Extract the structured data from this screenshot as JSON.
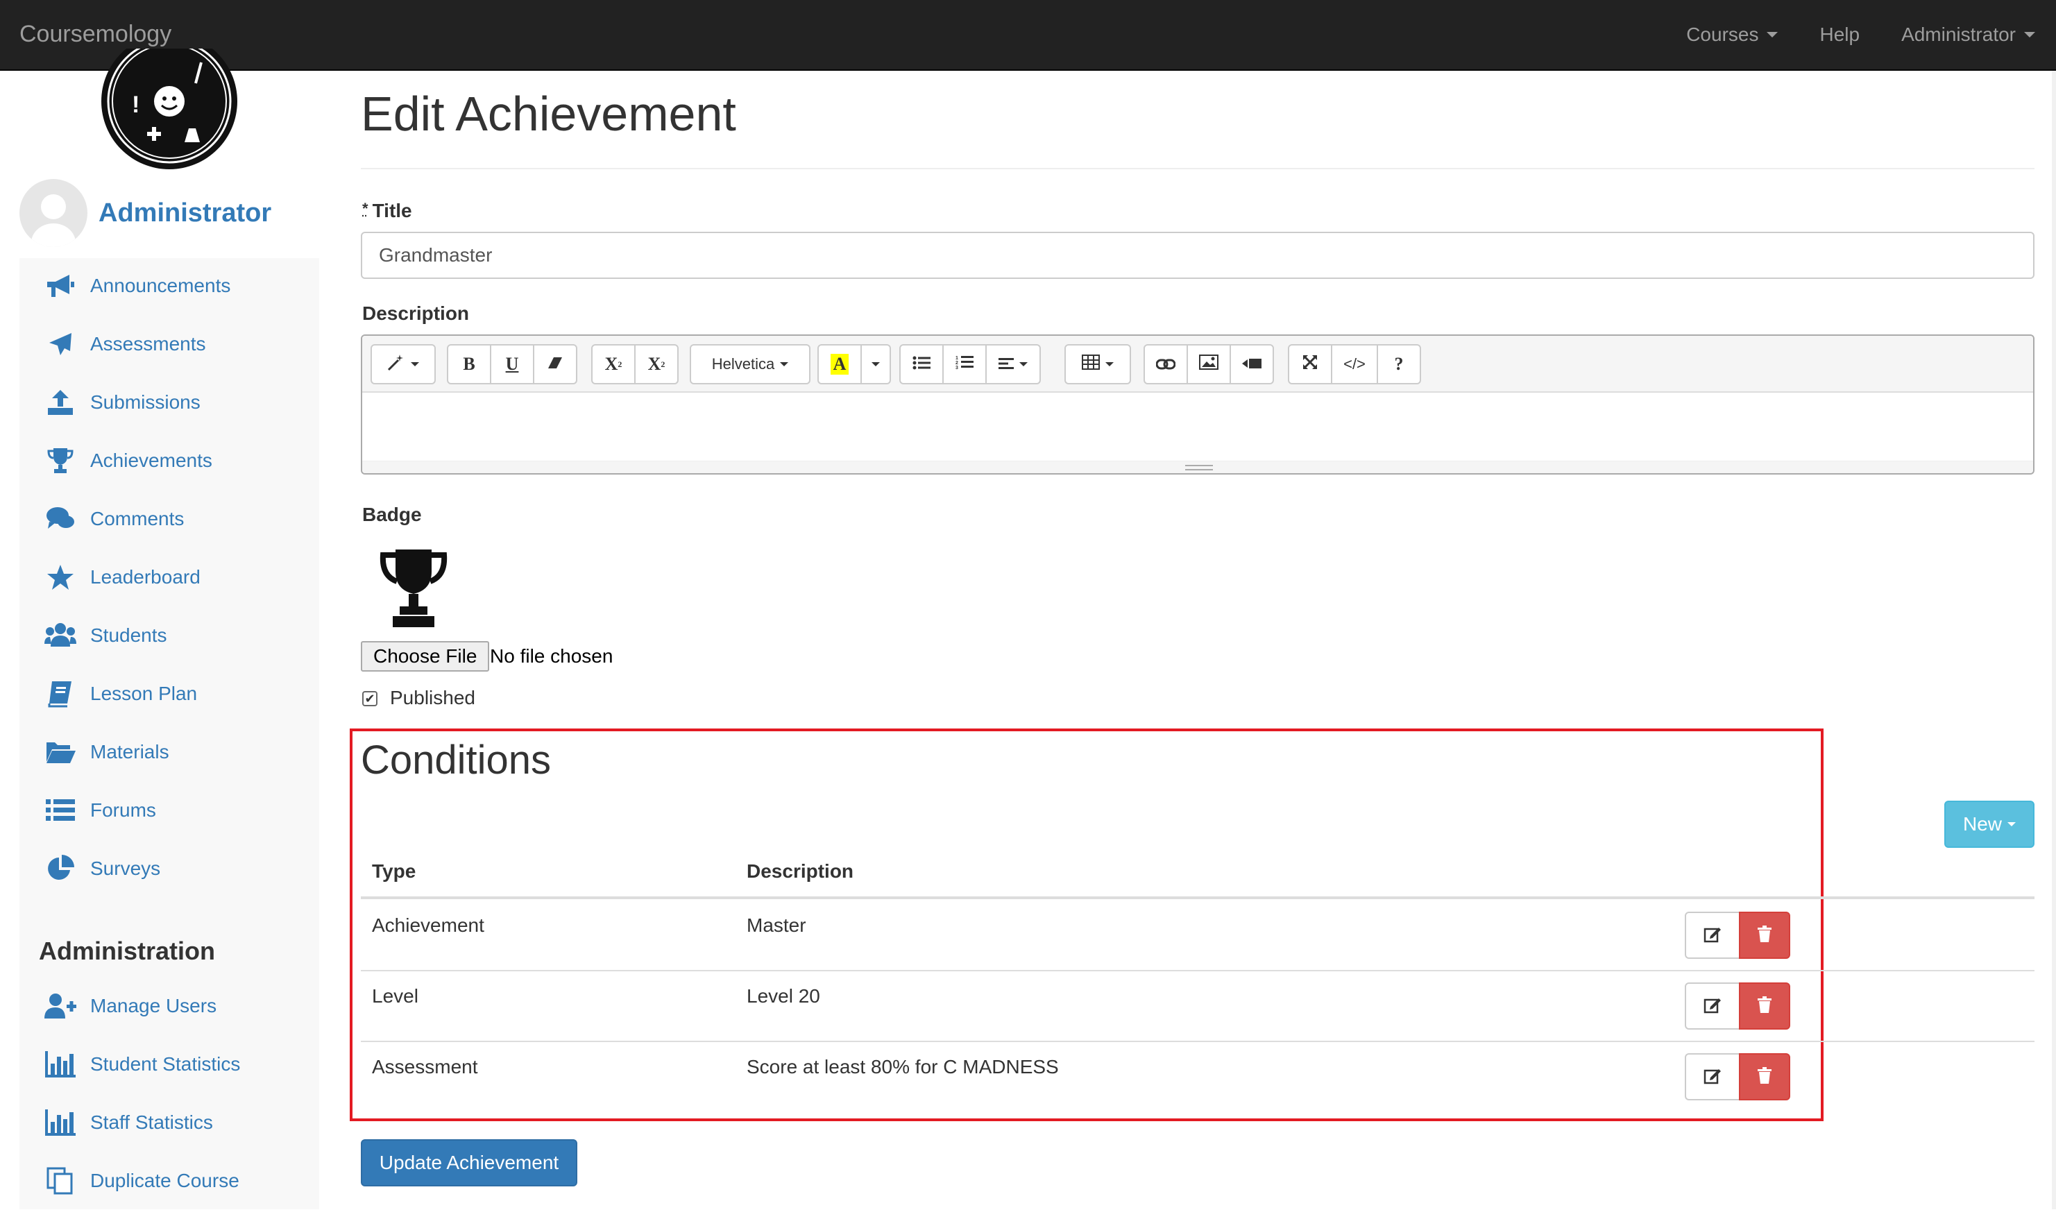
{
  "navbar": {
    "brand": "Coursemology",
    "links": [
      "Courses",
      "Help",
      "Administrator"
    ]
  },
  "sidebar": {
    "user_name": "Administrator",
    "items": [
      {
        "label": "Announcements",
        "icon": "megaphone-icon"
      },
      {
        "label": "Assessments",
        "icon": "plane-icon"
      },
      {
        "label": "Submissions",
        "icon": "upload-icon"
      },
      {
        "label": "Achievements",
        "icon": "trophy-icon"
      },
      {
        "label": "Comments",
        "icon": "comments-icon"
      },
      {
        "label": "Leaderboard",
        "icon": "star-icon"
      },
      {
        "label": "Students",
        "icon": "users-icon"
      },
      {
        "label": "Lesson Plan",
        "icon": "book-icon"
      },
      {
        "label": "Materials",
        "icon": "folder-open-icon"
      },
      {
        "label": "Forums",
        "icon": "list-icon"
      },
      {
        "label": "Surveys",
        "icon": "pie-chart-icon"
      }
    ],
    "admin_heading": "Administration",
    "admin_items": [
      {
        "label": "Manage Users",
        "icon": "user-plus-icon"
      },
      {
        "label": "Student Statistics",
        "icon": "bar-chart-icon"
      },
      {
        "label": "Staff Statistics",
        "icon": "bar-chart-icon"
      },
      {
        "label": "Duplicate Course",
        "icon": "copy-icon"
      }
    ]
  },
  "form": {
    "page_title": "Edit Achievement",
    "required_mark": "*",
    "title_label": "Title",
    "title_value": "Grandmaster",
    "description_label": "Description",
    "font_name": "Helvetica",
    "badge_label": "Badge",
    "choose_file": "Choose File",
    "no_file": "No file chosen",
    "published_label": "Published",
    "published": true,
    "submit_label": "Update Achievement"
  },
  "toolbar": {
    "bold": "B",
    "underline": "U",
    "superscript": "X",
    "subscript": "X",
    "code": "</>",
    "help": "?",
    "highlight": "A"
  },
  "conditions": {
    "title": "Conditions",
    "new_label": "New",
    "headers": [
      "Type",
      "Description"
    ],
    "rows": [
      {
        "type": "Achievement",
        "description": "Master"
      },
      {
        "type": "Level",
        "description": "Level 20"
      },
      {
        "type": "Assessment",
        "description": "Score at least 80% for C MADNESS"
      }
    ]
  },
  "colors": {
    "link": "#337ab7",
    "danger": "#d9534f",
    "info": "#5bc0de",
    "highlight_box": "#e31b23"
  }
}
